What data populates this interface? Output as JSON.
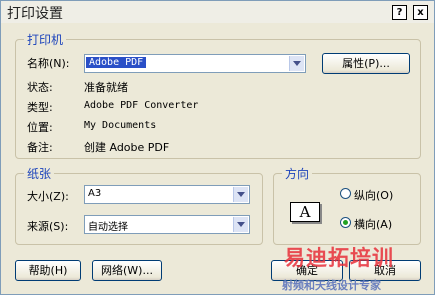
{
  "window": {
    "title": "打印设置",
    "help_button": "?",
    "close_button": "x"
  },
  "printer": {
    "legend": "打印机",
    "name_label": "名称(N):",
    "name_value": "Adobe PDF",
    "properties_button": "属性(P)...",
    "status_label": "状态:",
    "status_value": "准备就绪",
    "type_label": "类型:",
    "type_value": "Adobe PDF Converter",
    "where_label": "位置:",
    "where_value": "My Documents",
    "comment_label": "备注:",
    "comment_value": "创建 Adobe PDF"
  },
  "paper": {
    "legend": "纸张",
    "size_label": "大小(Z):",
    "size_value": "A3",
    "source_label": "来源(S):",
    "source_value": "自动选择"
  },
  "orientation": {
    "legend": "方向",
    "icon_letter": "A",
    "portrait_label": "纵向(O)",
    "landscape_label": "横向(A)",
    "selected": "landscape"
  },
  "buttons": {
    "help": "帮助(H)",
    "network": "网络(W)...",
    "ok": "确定",
    "cancel": "取消"
  },
  "watermark": {
    "line1": "易迪拓培训",
    "line2": "射频和天线设计专家"
  },
  "colors": {
    "accent": "#1d44bb",
    "selection": "#2a4fc7",
    "watermark_red": "#e8303a"
  }
}
